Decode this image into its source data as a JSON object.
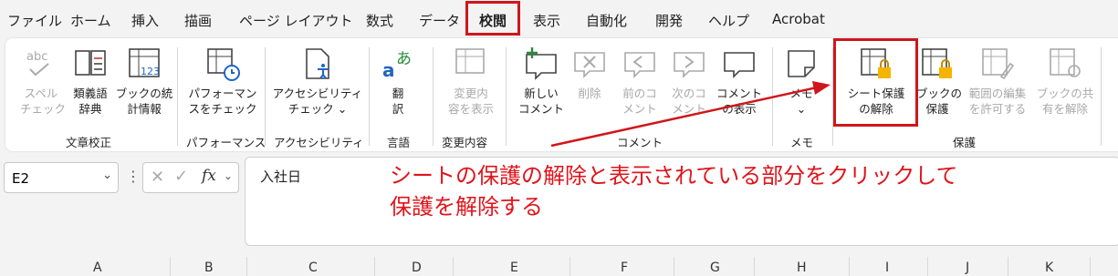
{
  "tabs": [
    "ファイル",
    "ホーム",
    "挿入",
    "描画",
    "ページ レイアウト",
    "数式",
    "データ",
    "校閲",
    "表示",
    "自動化",
    "開発",
    "ヘルプ",
    "Acrobat"
  ],
  "ribbon": {
    "spell": "スペル\nチェック",
    "thesaurus": "類義語\n辞典",
    "stats": "ブックの統\n計情報",
    "perf": "パフォーマン\nスをチェック",
    "access": "アクセシビリティ\nチェック ⌄",
    "translate": "翻\n訳",
    "showchanges": "変更内\n容を表示",
    "newcomment": "新しい\nコメント",
    "delete": "削除",
    "prev": "前のコ\nメント",
    "next": "次のコ\nメント",
    "showcomments": "コメント\nの表示",
    "memo": "メモ\n⌄",
    "unprotect": "シート保護\nの解除",
    "protectbook": "ブックの\n保護",
    "allowedit": "範囲の編集\nを許可する",
    "unshare": "ブックの共\n有を解除",
    "groups": {
      "proof": "文章校正",
      "perf": "パフォーマンス",
      "access": "アクセシビリティ",
      "lang": "言語",
      "changes": "変更内容",
      "comment": "コメント",
      "memo": "メモ",
      "protect": "保護"
    }
  },
  "namebox": "E2",
  "fx": "fx",
  "formula": "入社日",
  "annotation_line1": "シートの保護の解除と表示されている部分をクリックして",
  "annotation_line2": "保護を解除する",
  "columns": [
    "A",
    "B",
    "C",
    "D",
    "E",
    "F",
    "G",
    "H",
    "I",
    "J",
    "K"
  ]
}
